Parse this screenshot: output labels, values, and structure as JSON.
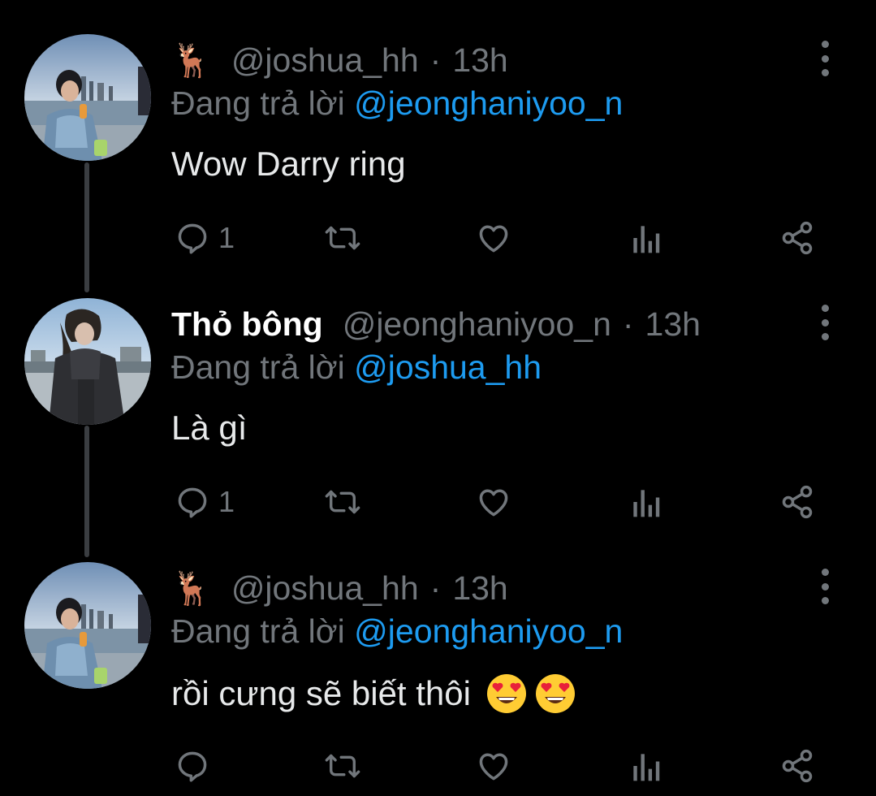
{
  "thread": [
    {
      "display_name": "",
      "name_emoji": "🦌",
      "handle": "@joshua_hh",
      "separator": "·",
      "time": "13h",
      "replying_prefix": "Đang trả lời",
      "replying_to": "@jeonghaniyoo_n",
      "text": "Wow Darry ring",
      "reply_count": "1",
      "text_emojis": []
    },
    {
      "display_name": "Thỏ bông",
      "name_emoji": "",
      "handle": "@jeonghaniyoo_n",
      "separator": "·",
      "time": "13h",
      "replying_prefix": "Đang trả lời",
      "replying_to": "@joshua_hh",
      "text": "Là gì",
      "reply_count": "1",
      "text_emojis": []
    },
    {
      "display_name": "",
      "name_emoji": "🦌",
      "handle": "@joshua_hh",
      "separator": "·",
      "time": "13h",
      "replying_prefix": "Đang trả lời",
      "replying_to": "@jeonghaniyoo_n",
      "text": "rồi cưng sẽ biết thôi",
      "reply_count": "",
      "text_emojis": [
        "heart-eyes-emoji",
        "heart-eyes-emoji"
      ]
    }
  ],
  "colors": {
    "background": "#000000",
    "text": "#e7e9ea",
    "secondary": "#71767b",
    "mention": "#1d9bf0",
    "thread_line": "#3a3d41"
  },
  "icons": {
    "reply": "reply-icon",
    "retweet": "retweet-icon",
    "like": "heart-icon",
    "views": "views-icon",
    "share": "share-icon",
    "more": "more-vertical-icon"
  }
}
